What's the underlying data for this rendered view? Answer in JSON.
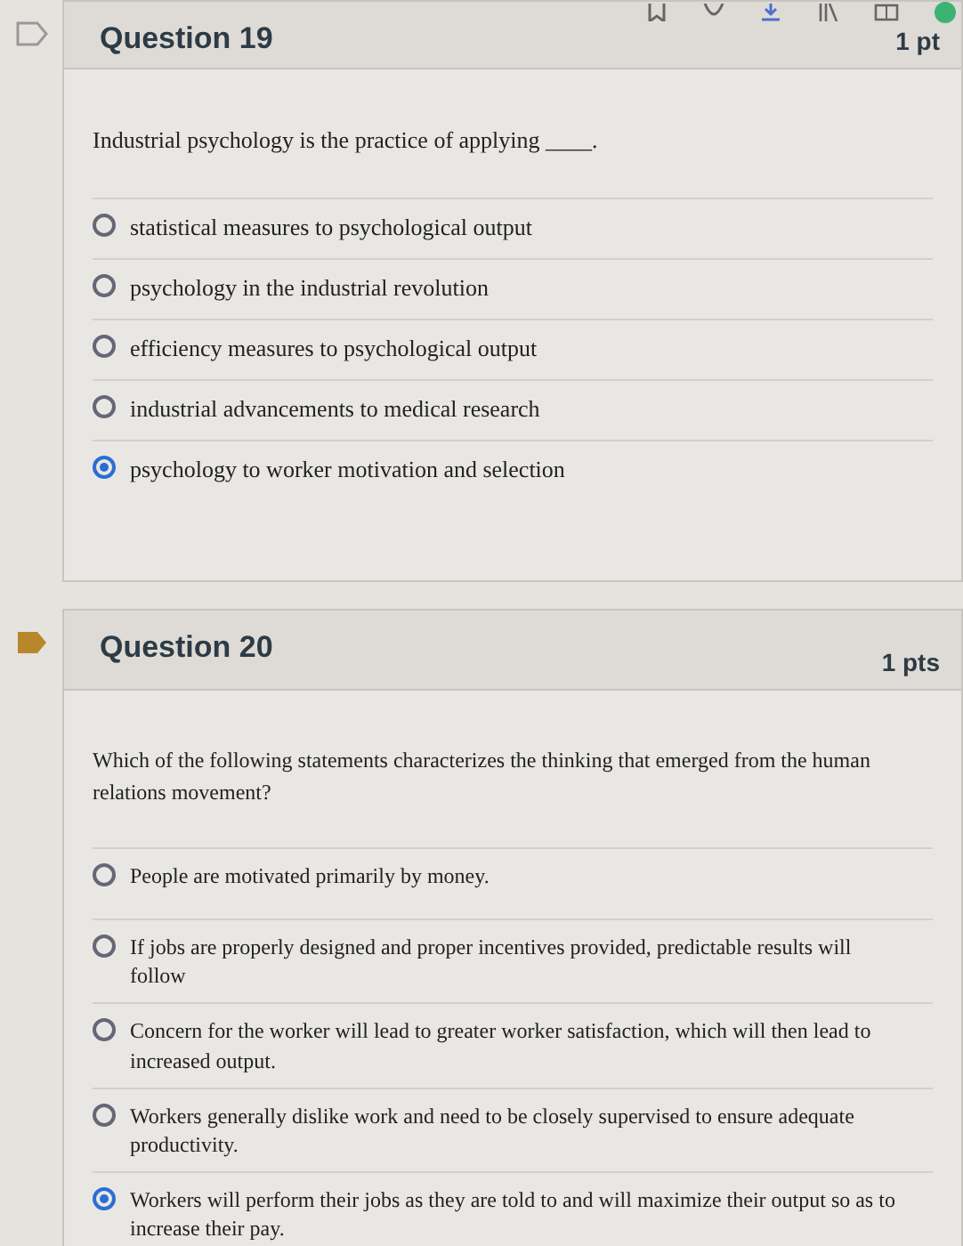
{
  "questions": [
    {
      "title": "Question 19",
      "points": "1 pt",
      "flagged": false,
      "prompt": "Industrial psychology is the practice of applying ____.",
      "answers": [
        {
          "text": "statistical measures to psychological output",
          "selected": false
        },
        {
          "text": "psychology in the industrial revolution",
          "selected": false
        },
        {
          "text": "efficiency measures to psychological output",
          "selected": false
        },
        {
          "text": "industrial advancements to medical research",
          "selected": false
        },
        {
          "text": "psychology to worker motivation and selection",
          "selected": true
        }
      ]
    },
    {
      "title": "Question 20",
      "points": "1 pts",
      "flagged": true,
      "prompt": "Which of the following statements characterizes the thinking that emerged from the human relations movement?",
      "answers": [
        {
          "text": "People are motivated primarily by money.",
          "selected": false
        },
        {
          "text": "If jobs are properly designed and proper incentives provided, predictable results will follow",
          "selected": false
        },
        {
          "text": "Concern for the worker will lead to greater worker satisfaction, which will then lead to increased output.",
          "selected": false
        },
        {
          "text": "Workers generally dislike work and need to be closely supervised to ensure adequate productivity.",
          "selected": false
        },
        {
          "text": "Workers will perform their jobs as they are told to and will maximize their output so as to increase their pay.",
          "selected": true
        }
      ]
    }
  ]
}
